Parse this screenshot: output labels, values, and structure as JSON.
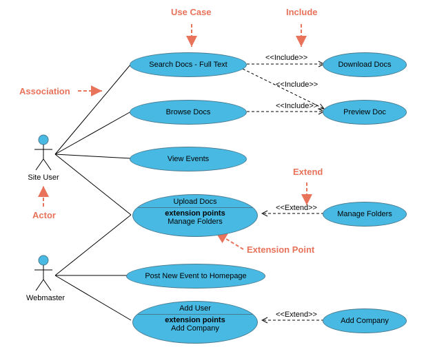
{
  "chart_data": {
    "type": "uml-use-case",
    "actors": [
      "Site User",
      "Webmaster"
    ],
    "use_cases": [
      "Search Docs - Full Text",
      "Browse Docs",
      "View Events",
      "Upload Docs",
      "Post New Event to Homepage",
      "Add User",
      "Download Docs",
      "Preview Doc",
      "Manage Folders",
      "Add Company"
    ],
    "extension_points": {
      "Upload Docs": "Manage Folders",
      "Add User": "Add Company"
    },
    "associations": [
      {
        "actor": "Site User",
        "use_case": "Search Docs - Full Text"
      },
      {
        "actor": "Site User",
        "use_case": "Browse Docs"
      },
      {
        "actor": "Site User",
        "use_case": "View Events"
      },
      {
        "actor": "Site User",
        "use_case": "Upload Docs"
      },
      {
        "actor": "Webmaster",
        "use_case": "Upload Docs"
      },
      {
        "actor": "Webmaster",
        "use_case": "Post New Event to Homepage"
      },
      {
        "actor": "Webmaster",
        "use_case": "Add User"
      }
    ],
    "include": [
      {
        "from": "Search Docs - Full Text",
        "to": "Download Docs"
      },
      {
        "from": "Search Docs - Full Text",
        "to": "Preview Doc"
      },
      {
        "from": "Browse Docs",
        "to": "Preview Doc"
      }
    ],
    "extend": [
      {
        "from": "Manage Folders",
        "to": "Upload Docs"
      },
      {
        "from": "Add Company",
        "to": "Add User"
      }
    ]
  },
  "annotations": {
    "use_case": "Use Case",
    "include": "Include",
    "association": "Association",
    "actor": "Actor",
    "extend": "Extend",
    "extension_point": "Extension Point"
  },
  "actors": {
    "site_user": "Site User",
    "webmaster": "Webmaster"
  },
  "usecases": {
    "search": "Search Docs - Full Text",
    "browse": "Browse Docs",
    "view_events": "View Events",
    "upload_title": "Upload Docs",
    "upload_ext_label": "extension points",
    "upload_ext_val": "Manage Folders",
    "post_event": "Post New Event to Homepage",
    "add_user_title": "Add User",
    "add_user_ext_label": "extension points",
    "add_user_ext_val": "Add Company",
    "download": "Download Docs",
    "preview": "Preview Doc",
    "manage_folders": "Manage Folders",
    "add_company": "Add Company"
  },
  "stereotypes": {
    "include1": "<<Include>>",
    "include2": "<<Include>>",
    "include3": "<<Include>>",
    "extend1": "<<Extend>>",
    "extend2": "<<Extend>>"
  }
}
